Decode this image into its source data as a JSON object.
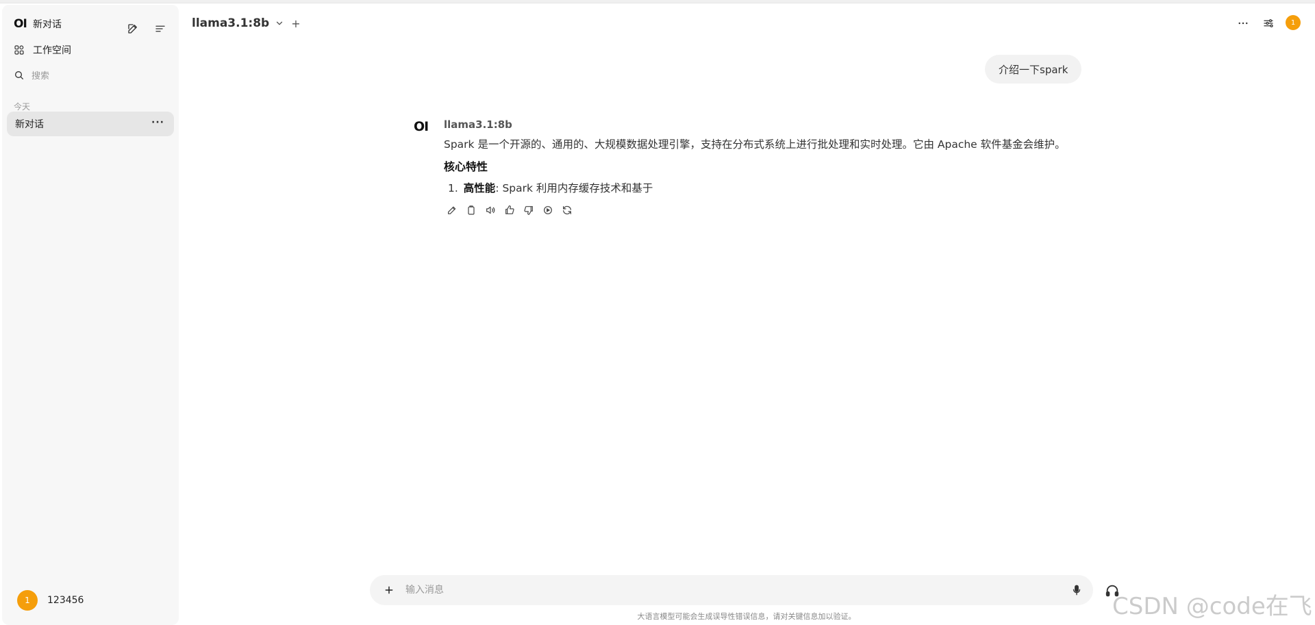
{
  "sidebar": {
    "logo": "OI",
    "new_chat_label": "新对话",
    "workspace_label": "工作空间",
    "search_placeholder": "搜索",
    "section_today": "今天",
    "chat_items": [
      {
        "label": "新对话"
      }
    ],
    "user": {
      "avatar": "1",
      "name": "123456"
    }
  },
  "header": {
    "model_name": "llama3.1:8b",
    "add_symbol": "+",
    "avatar": "1",
    "accent_color": "#f59e0b"
  },
  "chat": {
    "user_message": "介绍一下spark",
    "assistant": {
      "logo": "OI",
      "model_name": "llama3.1:8b",
      "paragraph": "Spark 是一个开源的、通用的、大规模数据处理引擎，支持在分布式系统上进行批处理和实时处理。它由 Apache 软件基金会维护。",
      "heading": "核心特性",
      "list": [
        {
          "num": "1.",
          "bold": "高性能",
          "rest": ": Spark 利用内存缓存技术和基于"
        }
      ]
    }
  },
  "input": {
    "placeholder": "输入消息",
    "disclaimer": "大语言模型可能会生成误导性错误信息，请对关键信息加以验证。"
  },
  "watermark": "CSDN @code在飞",
  "icons": [
    "pencil-square-icon",
    "sidebar-menu-icon",
    "workspace-grid-icon",
    "search-icon",
    "ellipsis-icon",
    "chevron-down-icon",
    "sliders-icon",
    "edit-icon",
    "copy-icon",
    "speaker-icon",
    "thumbs-up-icon",
    "thumbs-down-icon",
    "play-circle-icon",
    "refresh-icon",
    "plus-icon",
    "mic-icon",
    "headphones-icon"
  ]
}
